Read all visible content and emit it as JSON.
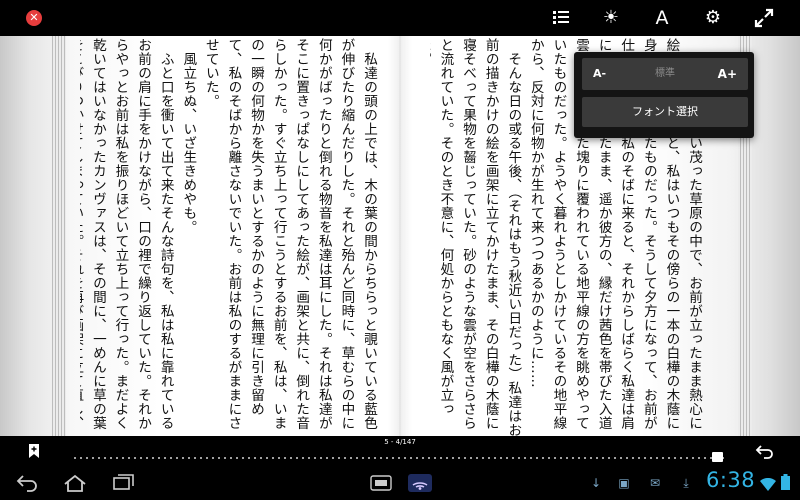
{
  "toolbar": {
    "close_glyph": "✕",
    "brightness_glyph": "☀",
    "font_glyph": "A",
    "settings_glyph": "⚙",
    "fullscreen_glyph": "⤢"
  },
  "font_popup": {
    "decrease_label": "A-",
    "size_label": "標準",
    "increase_label": "A+",
    "font_select_label": "フォント選択"
  },
  "reader": {
    "right_page": [
      "一面に薄の生い茂った草原の中で、お前が立ったまま熱心に絵を描いていると、私はいつもその傍らの一本の白樺の木蔭に身を横たえていたものだった。そうして夕方になって、お前が仕事をすませて私のそばに来ると、それからしばらく私達は肩に手をかけ合ったまま、遥か彼方の、縁だけ茜色を帯びた入道雲のむくむくした塊りに覆われている地平線の方を眺めやっていたものだった。ようやく暮れようとしかけているその地平線から、反対に何物かが生れて来つつあるかのように……",
      "",
      "そんな日の或る午後、（それはもう秋近い日だった）私達はお前の描きかけの絵を画架に立てかけたまま、その白樺の木蔭に寝そべって果物を齧じっていた。砂のような雲が空をさらさらと流れていた。そのとき不意に、何処からともなく風が立った。"
    ],
    "left_page": [
      "私達の頭の上では、木の葉の間からちらっと覗いている藍色が伸びたり縮んだりした。それと殆んど同時に、草むらの中に何かがばったりと倒れる物音を私達は耳にした。それは私達がそこに置きっぱなしにしてあった絵が、画架と共に、倒れた音らしかった。すぐ立ち上って行こうとするお前を、私は、いまの一瞬の何物かを失うまいとするかのように無理に引き留めて、私のそばから離さないでいた。お前は私のするがままにさせていた。",
      "",
      "風立ちぬ、いざ生きめやも。",
      "",
      "ふと口を衝いて出て来たそんな詩句を、私は私に靠れているお前の肩に手をかけながら、口の裡で繰り返していた。それからやっとお前は私を振りほどいて立ち上って行った。まだよく乾いてはいなかったカンヴァスは、その間に、一めんに草の葉をこびりつかせてしまっていた。それを再び画架に立て直し、パレット・ナイフでそんな"
    ],
    "page_indicator": "5 - 4/147",
    "progress_fraction": 0.998
  },
  "system_bar": {
    "clock": "6:38"
  }
}
